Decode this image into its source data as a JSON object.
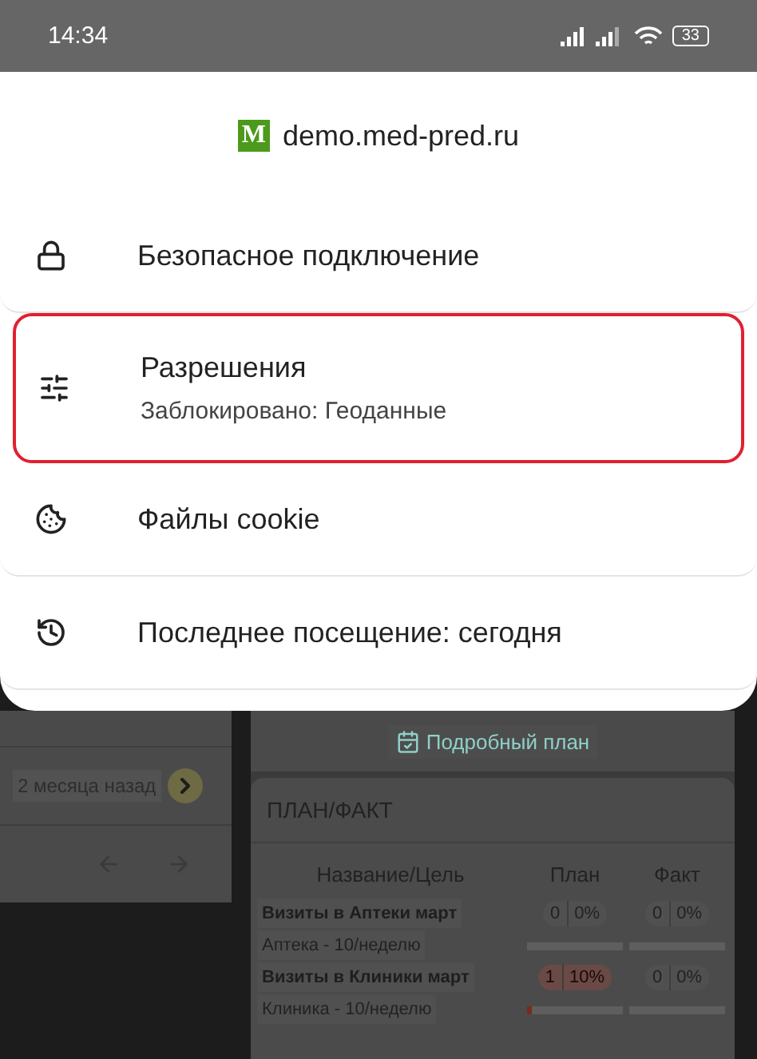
{
  "status_bar": {
    "time": "14:34",
    "battery": "33"
  },
  "site_sheet": {
    "logo_letter": "M",
    "site": "demo.med-pred.ru",
    "items": [
      {
        "kind": "lock",
        "title": "Безопасное подключение",
        "highlighted": false
      },
      {
        "kind": "permissions",
        "title": "Разрешения",
        "subtitle": "Заблокировано: Геоданные",
        "highlighted": true
      },
      {
        "kind": "cookie",
        "title": "Файлы cookie",
        "highlighted": false
      },
      {
        "kind": "history",
        "title": "Последнее посещение: сегодня",
        "highlighted": false
      }
    ]
  },
  "background_page": {
    "date_chip": "2 месяца назад",
    "plan_button": "Подробный план",
    "card_title": "ПЛАН/ФАКТ",
    "columns": [
      "Название/Цель",
      "План",
      "Факт"
    ],
    "rows": [
      {
        "name": "Визиты в Аптеки март",
        "goal": "Аптека - 10/неделю",
        "plan": {
          "count": "0",
          "pct": "0%",
          "alert": false,
          "level": 0
        },
        "fact": {
          "count": "0",
          "pct": "0%",
          "level": 0
        }
      },
      {
        "name": "Визиты в Клиники март",
        "goal": "Клиника - 10/неделю",
        "plan": {
          "count": "1",
          "pct": "10%",
          "alert": true,
          "level": 0.05
        },
        "fact": {
          "count": "0",
          "pct": "0%",
          "level": 0
        }
      }
    ]
  }
}
